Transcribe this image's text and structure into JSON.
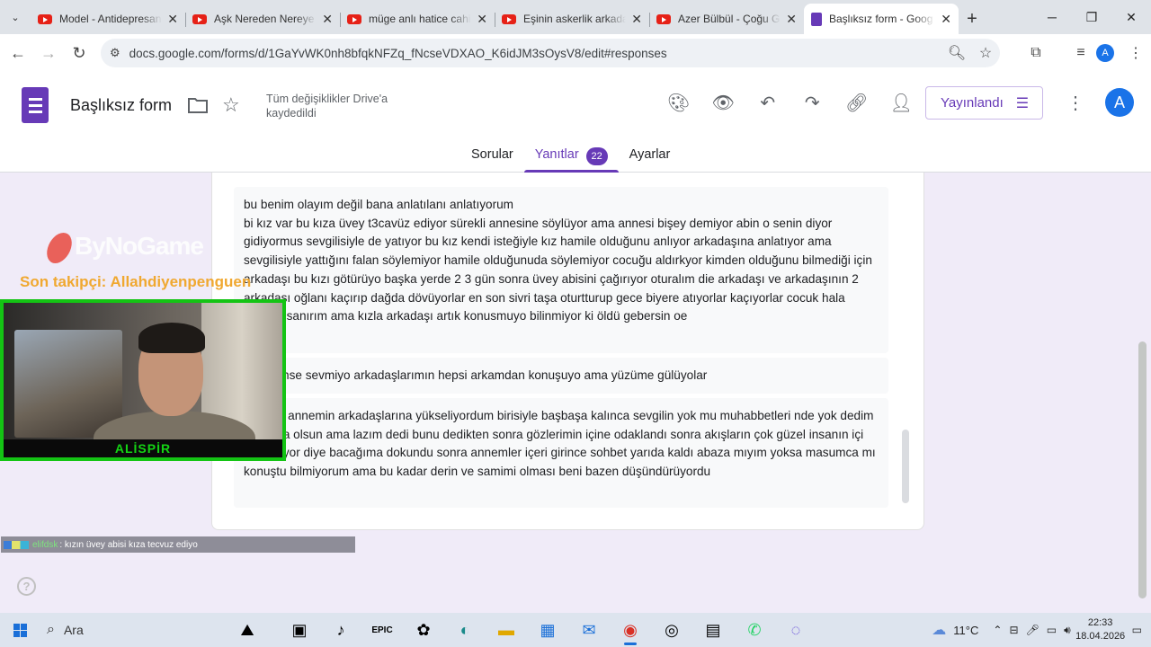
{
  "browser": {
    "tabs": [
      {
        "title": "Model - Antidepresan",
        "icon": "youtube-icon",
        "active": false
      },
      {
        "title": "Aşk Nereden Nereye",
        "icon": "youtube-icon",
        "active": false
      },
      {
        "title": "müge anlı hatice cahi",
        "icon": "youtube-icon",
        "active": false
      },
      {
        "title": "Eşinin askerlik arkada",
        "icon": "youtube-icon",
        "active": false
      },
      {
        "title": "Azer Bülbül - Çoğu G",
        "icon": "youtube-icon",
        "active": false
      },
      {
        "title": "Başlıksız form - Goog",
        "icon": "forms-icon",
        "active": true
      }
    ],
    "url": "docs.google.com/forms/d/1GaYvWK0nh8bfqkNFZq_fNcseVDXAO_K6idJM3sOysV8/edit#responses",
    "profile_initial": "A"
  },
  "form": {
    "title": "Başlıksız form",
    "save_status": "Tüm değişiklikler Drive'a kaydedildi",
    "publish_label": "Yayınlandı",
    "avatar_initial": "A",
    "tabs": [
      {
        "label": "Sorular",
        "active": false
      },
      {
        "label": "Yanıtlar",
        "active": true,
        "badge": "22"
      },
      {
        "label": "Ayarlar",
        "active": false
      }
    ],
    "responses": [
      {
        "text": "bu benim olayım değil bana anlatılanı anlatıyorum\nbi kız var bu kıza üvey t3cavüz ediyor sürekli annesine söylüyor ama annesi bişey demiyor abin o senin diyor gidiyormus sevgilisiyle de yatıyor bu kız kendi isteğiyle kız hamile olduğunu anlıyor arkadaşına anlatıyor ama sevgilisiyle yattığını falan söylemiyor hamile olduğunuda söylemiyor cocuğu aldırkyor kimden olduğunu bilmediği için arkadaşı bu kızı götürüyo başka yerde 2 3 gün sonra üvey abisini çağırıyor oturalım die arkadaşı ve arkadaşının 2 arkadaşı oğlanı kaçırıp dağda dövüyorlar en son sivri taşa oturtturup gece biyere atıyorlar kaçıyorlar cocuk hala yaşıyor sanırım ama kızla arkadaşı artık konusmuyo bilinmiyor ki öldü gebersin oe"
      },
      {
        "text": "beni kimse sevmiyo arkadaşlarımın hepsi arkamdan konuşuyo ama yüzüme gülüyolar"
      },
      {
        "text": "ününde annemin arkadaşlarına yükseliyordum birisiyle başbaşa kalınca sevgilin yok mu muhabbetleri nde yok dedim bu yaşta olsun ama lazım dedi bunu dedikten sonra gözlerimin içine odaklandı sonra akışların çok güzel insanın içi hoş oluyor diye bacağıma dokundu sonra annemler içeri girince sohbet yarıda kaldı abaza mıyım yoksa masumca mı konuştu bilmiyorum ama bu kadar derin ve samimi olması beni bazen düşündürüyordu"
      }
    ]
  },
  "overlay": {
    "logo_text": "ByNoGame",
    "follower_text": "Son takipçi: Allahdiyenpenguen",
    "streamer_name": "ALİSPİR",
    "chat_user": "elifdsk",
    "chat_message": ": kızın üvey abisi kıza tecvuz ediyo"
  },
  "taskbar": {
    "search_label": "Ara",
    "weather": "11°C",
    "time": "22:33",
    "date": "18.04.2026"
  },
  "colors": {
    "accent": "#673ab7",
    "page_bg": "#f0ebf8",
    "overlay_green": "#14c414",
    "follower_orange": "#f0a830"
  }
}
